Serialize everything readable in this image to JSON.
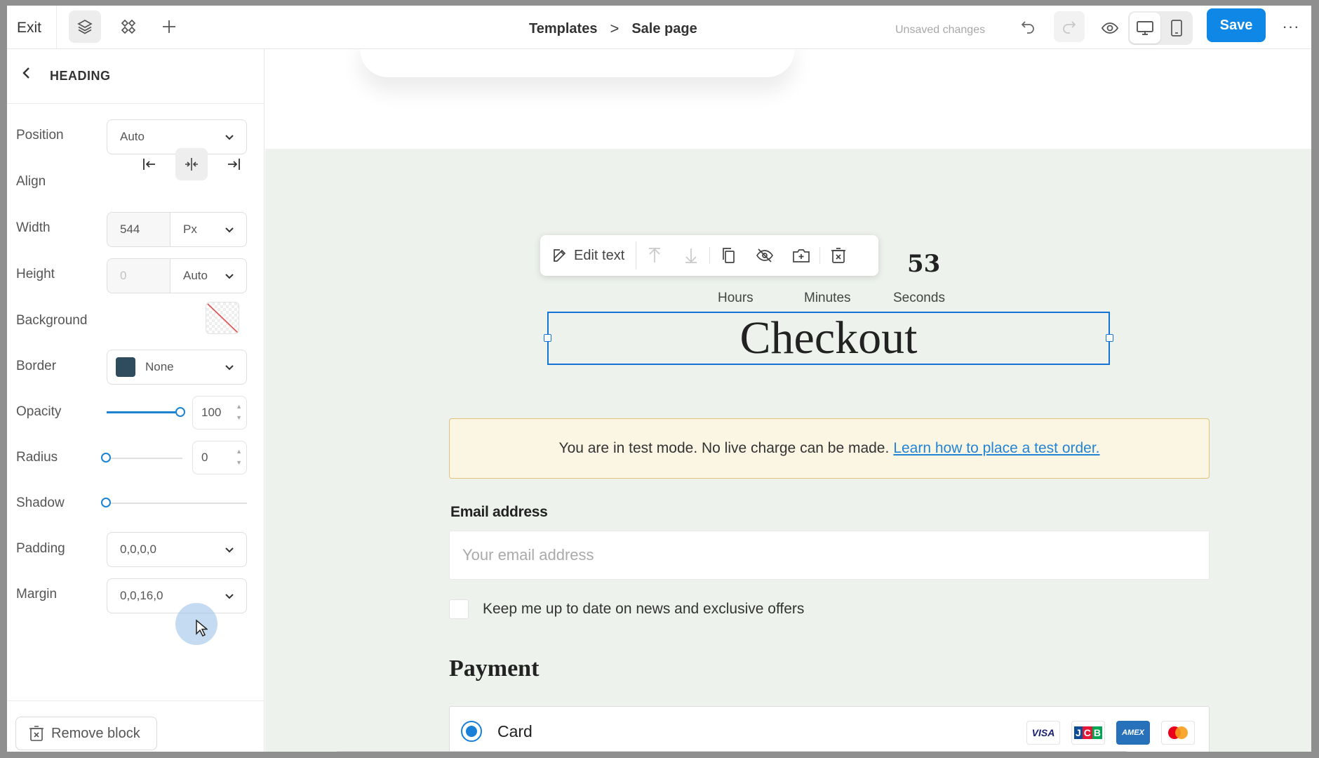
{
  "topbar": {
    "exit_label": "Exit",
    "breadcrumbs": [
      "Templates",
      "Sale page"
    ],
    "breadcrumb_separator": ">",
    "status": "Unsaved changes",
    "save_label": "Save",
    "more_label": "···",
    "icons": [
      "layers-icon",
      "components-icon",
      "plus-icon",
      "undo-icon",
      "redo-icon",
      "eye-icon",
      "desktop-icon",
      "mobile-icon"
    ]
  },
  "sidebar": {
    "title": "HEADING",
    "position": {
      "label": "Position",
      "value": "Auto"
    },
    "align": {
      "label": "Align",
      "options": [
        "left",
        "center",
        "right"
      ],
      "selected": "center"
    },
    "width": {
      "label": "Width",
      "value": "544",
      "unit": "Px"
    },
    "height": {
      "label": "Height",
      "value": "0",
      "unit": "Auto"
    },
    "background": {
      "label": "Background",
      "value": "none"
    },
    "border": {
      "label": "Border",
      "value": "None",
      "swatch_color": "#2f4b5e"
    },
    "opacity": {
      "label": "Opacity",
      "value": "100",
      "level": 1.0
    },
    "radius": {
      "label": "Radius",
      "value": "0",
      "level": 0.0
    },
    "shadow": {
      "label": "Shadow",
      "level": 0.0
    },
    "padding": {
      "label": "Padding",
      "value": "0,0,0,0"
    },
    "margin": {
      "label": "Margin",
      "value": "0,0,16,0"
    },
    "remove_label": "Remove block"
  },
  "canvas": {
    "toolbar": {
      "edit_label": "Edit text",
      "icons": [
        "move-up-icon",
        "move-down-icon",
        "duplicate-icon",
        "hide-icon",
        "save-block-icon",
        "delete-icon"
      ]
    },
    "countdown": [
      {
        "value": "",
        "label": "Hours"
      },
      {
        "value": "",
        "label": "Minutes"
      },
      {
        "value": "53",
        "label": "Seconds"
      }
    ],
    "heading": "Checkout",
    "notice": {
      "text": "You are in test mode. No live charge can be made.",
      "link": "Learn how to place a test order."
    },
    "email": {
      "label": "Email address",
      "placeholder": "Your email address"
    },
    "newsletter_label": "Keep me up to date on news and exclusive offers",
    "payment_title": "Payment",
    "card_label": "Card",
    "card_brands": [
      "VISA",
      "JCB",
      "AMEX",
      "mastercard"
    ],
    "colors": {
      "page_bg": "#edf3ec",
      "accent": "#0f87e6",
      "selection": "#1673d6",
      "notice_border": "#e3c277"
    }
  }
}
